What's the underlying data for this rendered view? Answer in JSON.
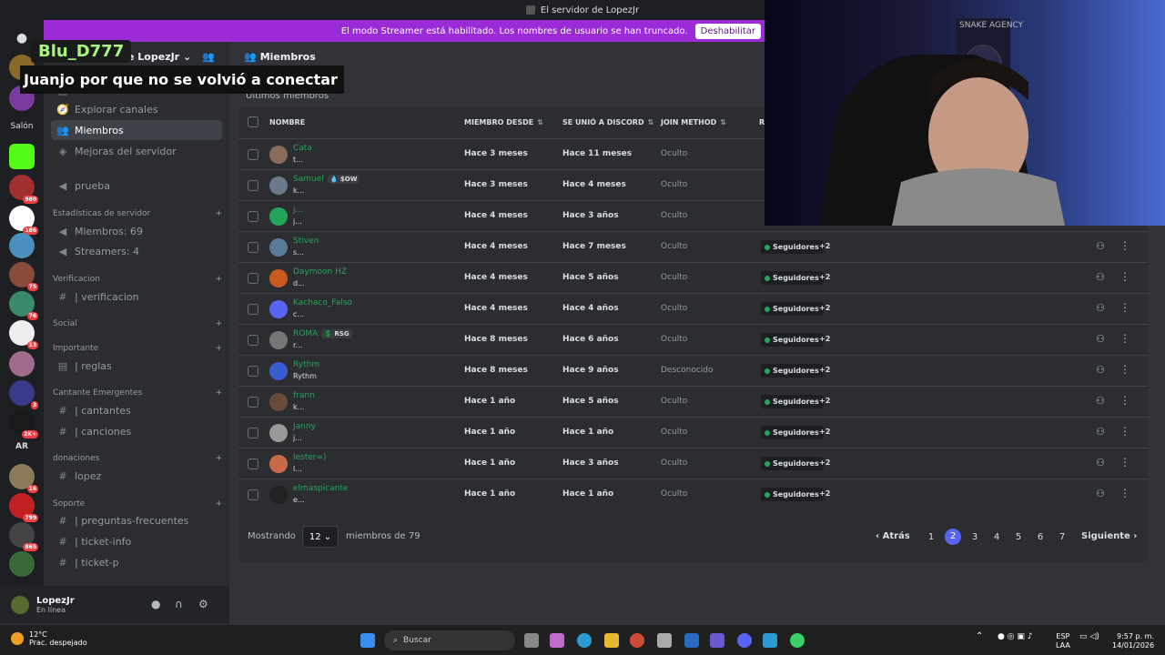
{
  "window": {
    "title": "El servidor de LopezJr"
  },
  "banner": {
    "text": "El modo Streamer está habilitado. Los nombres de usuario se han truncado.",
    "button": "Deshabilitar"
  },
  "overlay": {
    "name": "Blu_D777",
    "message": "Juanjo por que no se volvió a conectar"
  },
  "server": {
    "name": "e LopezJr",
    "chevron": "⌄"
  },
  "guilds": {
    "salon": "Salón",
    "ar": "AR",
    "badges": [
      "980",
      "186",
      "75",
      "76",
      "13",
      "3",
      "2K+",
      "16",
      "799",
      "865"
    ]
  },
  "channels": {
    "eventos": "Eventos",
    "explorar": "Explorar canales",
    "miembros": "Miembros",
    "mejoras": "Mejoras del servidor",
    "prueba": "prueba",
    "stats_cat": "Estadísticas de servidor",
    "miembros_count": "Miembros: 69",
    "streamers_count": "Streamers: 4",
    "cat_verificacion": "Verificacion",
    "verificacion": "| verificacion",
    "cat_social": "Social",
    "cat_importante": "Importante",
    "reglas": "| reglas",
    "cat_cantante": "Cantante Emergentes",
    "cantantes": "| cantantes",
    "canciones": "| canciones",
    "cat_donaciones": "donaciones",
    "lopez": "lopez",
    "cat_soporte": "Soporte",
    "preguntas": "| preguntas-frecuentes",
    "ticket_info": "| ticket-info",
    "ticket_p": "| ticket-p"
  },
  "user": {
    "name": "LopezJr",
    "status": "En línea"
  },
  "main": {
    "header": "Miembros",
    "subheading": "Últimos miembros",
    "columns": {
      "name": "NOMBRE",
      "member_since": "MIEMBRO DESDE",
      "joined_discord": "SE UNIÓ A DISCORD",
      "join_method": "JOIN METHOD",
      "roles": "R"
    },
    "rows": [
      {
        "name": "Cata",
        "sub": "t...",
        "member": "Hace 3 meses",
        "discord": "Hace 11 meses",
        "method": "Oculto",
        "role": "",
        "plus": "",
        "avatar": "#8a6a5a"
      },
      {
        "name": "Samuel",
        "tag": "💧 $OW",
        "sub": "k...",
        "member": "Hace 3 meses",
        "discord": "Hace 4 meses",
        "method": "Oculto",
        "role": "",
        "plus": "",
        "avatar": "#6a7a8a"
      },
      {
        "name": "j...",
        "sub": "j...",
        "member": "Hace 4 meses",
        "discord": "Hace 3 años",
        "method": "Oculto",
        "role": "",
        "plus": "",
        "avatar": "#23a559"
      },
      {
        "name": "Stiven",
        "sub": "s...",
        "member": "Hace 4 meses",
        "discord": "Hace 7 meses",
        "method": "Oculto",
        "role": "Seguidores",
        "plus": "+2",
        "avatar": "#5a7a9a"
      },
      {
        "name": "Daymoon HZ",
        "sub": "d...",
        "member": "Hace 4 meses",
        "discord": "Hace 5 años",
        "method": "Oculto",
        "role": "Seguidores",
        "plus": "+2",
        "avatar": "#c85a20"
      },
      {
        "name": "Kachaco_Falso",
        "sub": "c...",
        "member": "Hace 4 meses",
        "discord": "Hace 4 años",
        "method": "Oculto",
        "role": "Seguidores",
        "plus": "+2",
        "avatar": "#5865f2"
      },
      {
        "name": "ROMA",
        "tag": "💲 RSG",
        "sub": "r...",
        "member": "Hace 8 meses",
        "discord": "Hace 6 años",
        "method": "Oculto",
        "role": "Seguidores",
        "plus": "+2",
        "avatar": "#777"
      },
      {
        "name": "Rythm",
        "sub": "Rythm",
        "member": "Hace 8 meses",
        "discord": "Hace 9 años",
        "method": "Desconocido",
        "role": "Seguidores",
        "plus": "+2",
        "avatar": "#3a5ad0"
      },
      {
        "name": "frann",
        "sub": "k...",
        "member": "Hace 1 año",
        "discord": "Hace 5 años",
        "method": "Oculto",
        "role": "Seguidores",
        "plus": "+2",
        "avatar": "#6a4a3a"
      },
      {
        "name": "Janny",
        "sub": "j...",
        "member": "Hace 1 año",
        "discord": "Hace 1 año",
        "method": "Oculto",
        "role": "Seguidores",
        "plus": "+2",
        "avatar": "#999"
      },
      {
        "name": "lester=)",
        "sub": "l...",
        "member": "Hace 1 año",
        "discord": "Hace 3 años",
        "method": "Oculto",
        "role": "Seguidores",
        "plus": "+2",
        "avatar": "#c86a4a"
      },
      {
        "name": "elmaspicante",
        "sub": "e...",
        "member": "Hace 1 año",
        "discord": "Hace 1 año",
        "method": "Oculto",
        "role": "Seguidores",
        "plus": "+2",
        "avatar": "#222"
      }
    ],
    "pager": {
      "showing": "Mostrando",
      "per_page": "12",
      "of": "miembros de 79",
      "prev": "‹ Atrás",
      "next": "Siguiente ›",
      "pages": [
        "1",
        "2",
        "3",
        "4",
        "5",
        "6",
        "7"
      ],
      "current": "2"
    }
  },
  "webcam": {
    "sign": "SNAKE AGENCY"
  },
  "taskbar": {
    "temp": "12°C",
    "weather": "Prac. despejado",
    "search": "Buscar",
    "lang1": "ESP",
    "lang2": "LAA",
    "time": "9:57 p. m.",
    "date": "14/01/2026"
  },
  "icons": {
    "hash": "#",
    "speaker": "🔊",
    "compass": "🧭",
    "members": "👥",
    "boost": "◈",
    "mic": "🎤",
    "headphones": "🎧",
    "gear": "⚙",
    "person": "👤",
    "kebab": "⋮",
    "sort": "⇅",
    "plus": "+",
    "chevron": "⌄",
    "chevron_right": "›",
    "search": "🔍",
    "discord": "💬"
  }
}
